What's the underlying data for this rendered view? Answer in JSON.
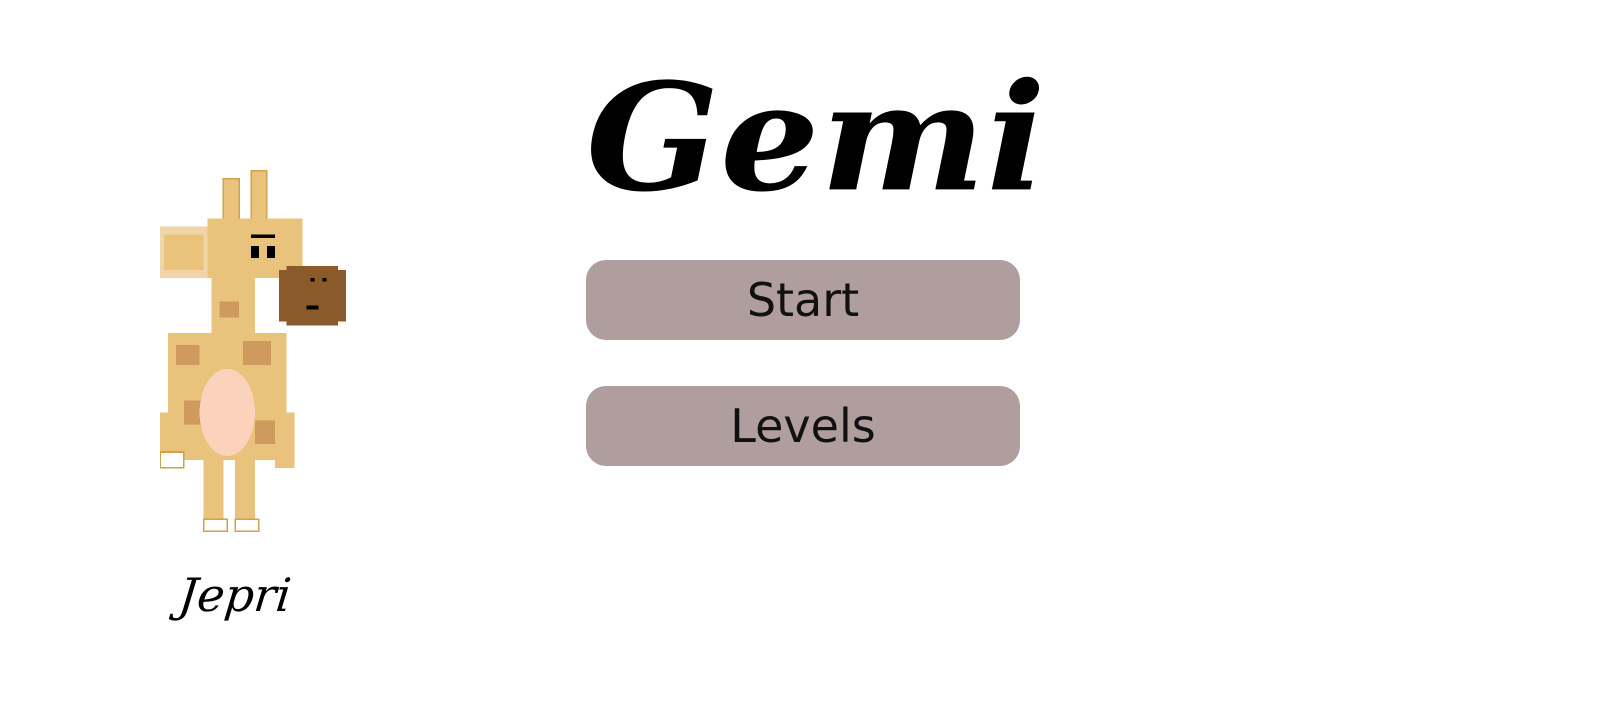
{
  "title": "Gemi",
  "character": {
    "name": "Jepri",
    "icon": "giraffe-character-icon"
  },
  "menu": {
    "start_label": "Start",
    "levels_label": "Levels"
  },
  "colors": {
    "background": "#ffffff",
    "button_bg": "#b09e9f",
    "text": "#000000",
    "giraffe_body": "#e9c27c",
    "giraffe_spots": "#cf9a5d",
    "giraffe_belly": "#fbd3bd",
    "giraffe_snout": "#8b5a2b"
  }
}
